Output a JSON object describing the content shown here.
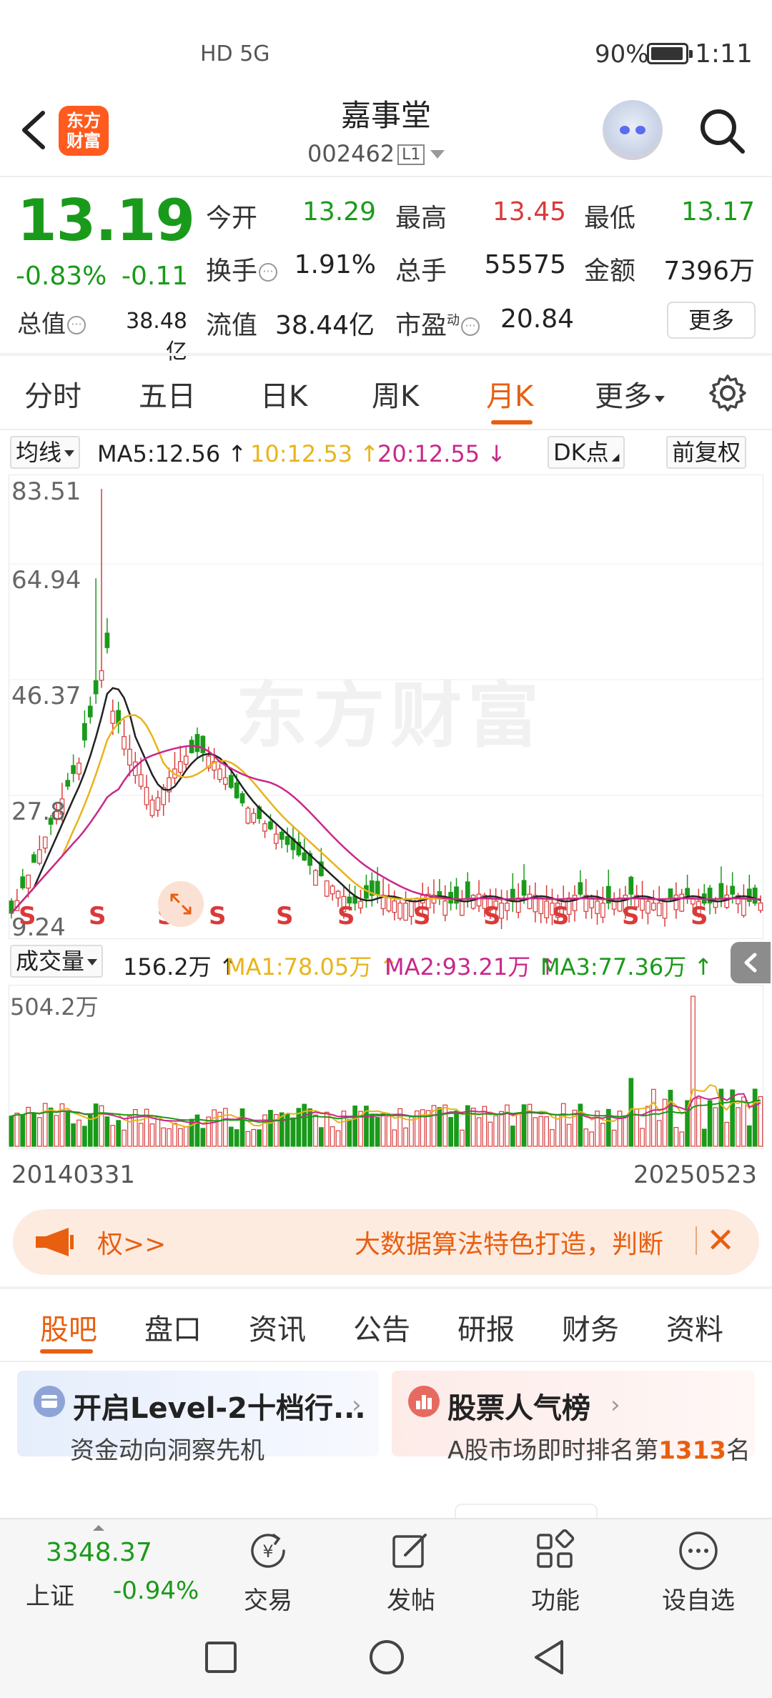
{
  "status_bar": {
    "network": "HD 5G",
    "battery": "90%",
    "time": "1:11"
  },
  "header": {
    "logo_line1": "东方",
    "logo_line2": "财富",
    "stock_name": "嘉事堂",
    "stock_code": "002462",
    "level_badge": "L1"
  },
  "quote": {
    "price": "13.19",
    "change_pct": "-0.83%",
    "change": "-0.11",
    "total_value_label": "总值",
    "total_value": "38.48亿",
    "rows": [
      [
        {
          "label": "今开",
          "value": "13.29",
          "color": "#1a9a1a"
        },
        {
          "label": "最高",
          "value": "13.45",
          "color": "#d93a3a"
        },
        {
          "label": "最低",
          "value": "13.17",
          "color": "#1a9a1a"
        }
      ],
      [
        {
          "label": "换手",
          "value": "1.91%",
          "color": "#222222"
        },
        {
          "label": "总手",
          "value": "55575",
          "color": "#222222"
        },
        {
          "label": "金额",
          "value": "7396万",
          "color": "#222222"
        }
      ]
    ],
    "float_label": "流值",
    "float_value": "38.44亿",
    "pe_label": "市盈",
    "pe_sup": "动",
    "pe_value": "20.84",
    "more": "更多"
  },
  "period_tabs": [
    "分时",
    "五日",
    "日K",
    "周K",
    "月K",
    "更多"
  ],
  "active_period": "月K",
  "ma_bar": {
    "selector": "均线",
    "ma5": "MA5:12.56",
    "ma10": "10:12.53",
    "ma20": "20:12.55",
    "dk": "DK点",
    "adjust": "前复权"
  },
  "kline": {
    "y_ticks": [
      "83.51",
      "64.94",
      "46.37",
      "27.8",
      "9.24"
    ],
    "watermark": "东方财富",
    "signal": "S"
  },
  "volume_bar": {
    "selector": "成交量",
    "vol": "156.2万",
    "ma1": "MA1:78.05万",
    "ma2": "MA2:93.21万",
    "ma3": "MA3:77.36万",
    "max": "504.2万"
  },
  "dates": {
    "start": "20140331",
    "end": "20250523"
  },
  "banner": {
    "left": "权>>",
    "right": "大数据算法特色打造，判断"
  },
  "content_tabs": [
    "股吧",
    "盘口",
    "资讯",
    "公告",
    "研报",
    "财务",
    "资料"
  ],
  "cards": {
    "level2_title": "开启Level-2十档行...",
    "level2_sub": "资金动向洞察先机",
    "hot_title": "股票人气榜",
    "hot_sub_pre": "A股市场即时排名第",
    "hot_rank": "1313",
    "hot_sub_post": "名"
  },
  "bottom_nav": {
    "index_value": "3348.37",
    "index_name": "上证",
    "index_change": "-0.94%",
    "items": [
      "交易",
      "发帖",
      "功能",
      "设自选"
    ]
  },
  "colors": {
    "accent": "#e85f10",
    "up": "#d93a3a",
    "down": "#1a9a1a",
    "ma5": "#222222",
    "ma10": "#e8b41a",
    "ma20": "#c8288c"
  }
}
